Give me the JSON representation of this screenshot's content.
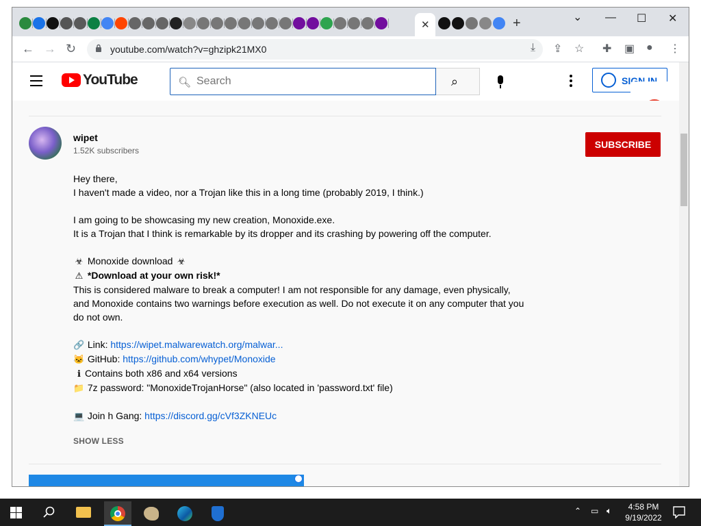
{
  "browser": {
    "url": "youtube.com/watch?v=ghzipk21MX0",
    "tab_close_glyph": "✕",
    "new_tab_glyph": "+",
    "tab_favicon_colors": [
      "#2b8a3e",
      "#1a73e8",
      "#111111",
      "#555555",
      "#5a5a5a",
      "#0b8043",
      "#4285f4",
      "#ff4500",
      "#666666",
      "#666666",
      "#666666",
      "#222222",
      "#888888",
      "#777777",
      "#777777",
      "#777777",
      "#777777",
      "#777777",
      "#777777",
      "#777777",
      "#720e9e",
      "#720e9e",
      "#2ea44f",
      "#777777",
      "#777777",
      "#777777",
      "#720e9e"
    ],
    "after_active_favicon_colors": [
      "#111111",
      "#111111",
      "#777777",
      "#888888",
      "#4285f4"
    ],
    "window_controls": {
      "minimize": "—",
      "maximize": "☐",
      "close": "✕",
      "dropdown": "⌄"
    }
  },
  "youtube": {
    "logo_text": "YouTube",
    "search_placeholder": "Search",
    "sign_in_label": "SIGN IN"
  },
  "channel": {
    "name": "wipet",
    "subscribers": "1.52K subscribers",
    "subscribe_label": "SUBSCRIBE"
  },
  "description": {
    "line1": "Hey there,",
    "line2": "I haven't made a video, nor a Trojan like this in a long time (probably 2019, I think.)",
    "line3": "I am going to be showcasing my new creation, Monoxide.exe.",
    "line4": "It is a Trojan that I think is remarkable by its dropper and its crashing by powering off the computer.",
    "download_heading": "Monoxide download",
    "download_emoji": "☣",
    "warning_emoji": "⚠",
    "warning_text": "*Download at your own risk!*",
    "disclaimer": "This is considered malware to break a computer! I am not responsible for any damage, even physically, and Monoxide contains two warnings before execution as well. Do not execute it on any computer that you do not own.",
    "link_emoji": "🔗",
    "link_label": "Link:",
    "link_url": "https://wipet.malwarewatch.org/malwar...",
    "github_emoji": "🐱",
    "github_label": "GitHub:",
    "github_url": "https://github.com/whypet/Monoxide",
    "info_emoji": "ℹ",
    "versions": "Contains both x86 and x64 versions",
    "folder_emoji": "📁",
    "password": "7z password: \"MonoxideTrojanHorse\" (also located in 'password.txt' file)",
    "laptop_emoji": "💻",
    "discord_label": "Join h Gang:",
    "discord_url": "https://discord.gg/cVf3ZKNEUc",
    "show_less": "SHOW LESS"
  },
  "taskbar": {
    "time": "4:58 PM",
    "date": "9/19/2022"
  }
}
